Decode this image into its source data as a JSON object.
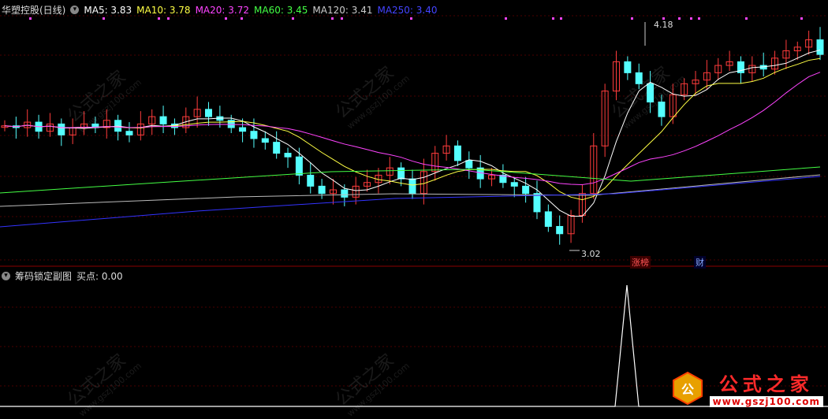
{
  "header": {
    "stock_name": "华塑控股(日线)",
    "ma": [
      {
        "label": "MA5: 3.83",
        "color": "#ffffff"
      },
      {
        "label": "MA10: 3.78",
        "color": "#ffff44"
      },
      {
        "label": "MA20: 3.72",
        "color": "#ff44ff"
      },
      {
        "label": "MA60: 3.45",
        "color": "#44ff44"
      },
      {
        "label": "MA120: 3.41",
        "color": "#cccccc"
      },
      {
        "label": "MA250: 3.40",
        "color": "#4444ff"
      }
    ]
  },
  "annotations": {
    "high": "4.18",
    "low": "3.02",
    "tag_zhangbang": "涨榜",
    "tag_cai": "财"
  },
  "sub_panel": {
    "title": "筹码锁定副图",
    "buy_label": "买点: 0.00"
  },
  "watermark": {
    "cn": "公式之家",
    "url": "www.gszj100.com"
  },
  "logo": {
    "cn": "公式之家",
    "url": "www.gszj100.com"
  },
  "colors": {
    "up": "#ff3c3c",
    "down": "#54ffff",
    "grid": "#8b0000"
  }
}
